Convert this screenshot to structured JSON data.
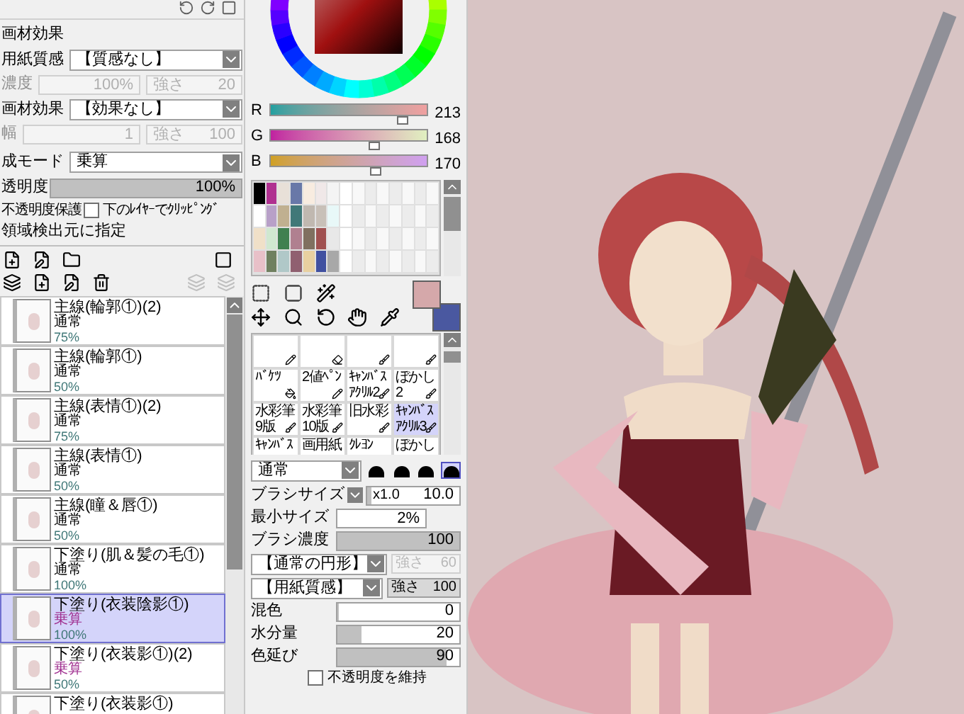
{
  "material_effects": {
    "heading": "画材効果",
    "paper": {
      "label": "用紙質感",
      "value": "【質感なし】",
      "sub_label": "濃度",
      "amount": "100%",
      "strength_label": "強さ",
      "strength": "20"
    },
    "effect": {
      "label": "画材効果",
      "value": "【効果なし】",
      "sub_label": "幅",
      "amount": "1",
      "strength_label": "強さ",
      "strength": "100"
    }
  },
  "blend_mode": {
    "label": "成モード",
    "value": "乗算"
  },
  "opacity": {
    "label": "透明度",
    "value": "100%",
    "level": 1
  },
  "options": [
    {
      "label": "不透明度保護"
    },
    {
      "label": "下のﾚｲﾔｰでｸﾘｯﾋﾟﾝｸﾞ",
      "checked": false
    }
  ],
  "selection_source": "領域検出元に指定",
  "layers": [
    {
      "name": "主線(輪郭①)(2)",
      "mode": "通常",
      "opacity": "75%",
      "selected": false
    },
    {
      "name": "主線(輪郭①)",
      "mode": "通常",
      "opacity": "50%",
      "selected": false
    },
    {
      "name": "主線(表情①)(2)",
      "mode": "通常",
      "opacity": "75%",
      "selected": false
    },
    {
      "name": "主線(表情①)",
      "mode": "通常",
      "opacity": "50%",
      "selected": false
    },
    {
      "name": "主線(瞳＆唇①)",
      "mode": "通常",
      "opacity": "50%",
      "selected": false
    },
    {
      "name": "下塗り(肌＆髪の毛①)",
      "mode": "通常",
      "opacity": "100%",
      "selected": false
    },
    {
      "name": "下塗り(衣装陰影①)",
      "mode": "乗算",
      "opacity": "100%",
      "selected": true
    },
    {
      "name": "下塗り(衣装影①)(2)",
      "mode": "乗算",
      "opacity": "50%",
      "selected": false
    },
    {
      "name": "下塗り(衣装影①)",
      "selected": false
    }
  ],
  "channels": [
    {
      "name": "R",
      "value": "213",
      "level": 0.84
    },
    {
      "name": "G",
      "value": "168",
      "level": 0.66
    },
    {
      "name": "B",
      "value": "170",
      "level": 0.67
    }
  ],
  "brushes": [
    {
      "selected": false
    },
    {
      "selected": false
    },
    {
      "selected": false
    },
    {
      "selected": false
    },
    {
      "label": "ﾊﾞｹﾂ",
      "selected": false
    },
    {
      "label": "2値ﾍﾟﾝ",
      "selected": false
    },
    {
      "label": "ｷｬﾝﾊﾞｽｱｸﾘﾙ2",
      "selected": false
    },
    {
      "label": "ぼかし2",
      "selected": false
    },
    {
      "label": "水彩筆 9版",
      "selected": false
    },
    {
      "label": "水彩筆 10版",
      "selected": false
    },
    {
      "label": "旧水彩",
      "selected": false
    },
    {
      "label": "ｷｬﾝﾊﾞｽｱｸﾘﾙ3",
      "selected": true
    },
    {
      "label": "ｷｬﾝﾊﾞｽ",
      "selected": false
    },
    {
      "label": "画用紙",
      "selected": false
    },
    {
      "label": "ｸﾚﾖﾝ",
      "selected": false
    },
    {
      "label": "ぼかし",
      "selected": false
    }
  ],
  "brush_mode": "通常",
  "brush_shapes": [
    {
      "selected": false
    },
    {
      "selected": false
    },
    {
      "selected": false
    },
    {
      "selected": true
    }
  ],
  "brush_settings": [
    {
      "kind": "size",
      "label": "ブラシサイズ",
      "multiplier": "x1.0",
      "value": "10.0",
      "level": 0.05
    },
    {
      "kind": "box",
      "label": "最小サイズ",
      "value": "2%"
    },
    {
      "kind": "slider",
      "label": "ブラシ濃度",
      "value": "100",
      "level": 1
    },
    {
      "kind": "texture",
      "value": "【通常の円形】",
      "strength_label": "強さ",
      "strength": "60",
      "disabled": true
    },
    {
      "kind": "texture",
      "value": "【用紙質感】",
      "strength_label": "強さ",
      "strength": "100",
      "disabled": false
    },
    {
      "kind": "slider",
      "label": "混色",
      "value": "0",
      "level": 0
    },
    {
      "kind": "slider",
      "label": "水分量",
      "value": "20",
      "level": 0.2
    },
    {
      "kind": "slider",
      "label": "色延び",
      "value": "90",
      "level": 0.9
    },
    {
      "kind": "check",
      "label": "不透明度を維持",
      "checked": false
    }
  ]
}
